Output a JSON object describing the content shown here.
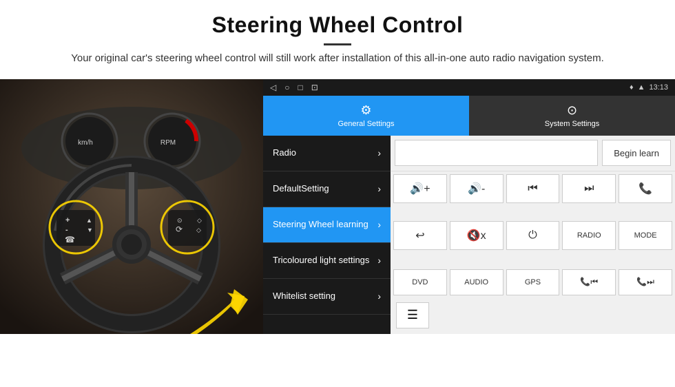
{
  "header": {
    "title": "Steering Wheel Control",
    "subtitle": "Your original car's steering wheel control will still work after installation of this all-in-one auto radio navigation system."
  },
  "statusBar": {
    "time": "13:13",
    "icons": [
      "◁",
      "○",
      "□",
      "⊡"
    ]
  },
  "navTabs": [
    {
      "id": "general",
      "label": "General Settings",
      "icon": "⚙",
      "active": true
    },
    {
      "id": "system",
      "label": "System Settings",
      "icon": "⊙",
      "active": false
    }
  ],
  "menuItems": [
    {
      "id": "radio",
      "label": "Radio",
      "active": false
    },
    {
      "id": "default",
      "label": "DefaultSetting",
      "active": false
    },
    {
      "id": "steering",
      "label": "Steering Wheel learning",
      "active": true
    },
    {
      "id": "tricoloured",
      "label": "Tricoloured light settings",
      "active": false
    },
    {
      "id": "whitelist",
      "label": "Whitelist setting",
      "active": false
    }
  ],
  "beginLearnBtn": "Begin learn",
  "controlButtons": {
    "row1": [
      {
        "label": "🔊+",
        "type": "icon"
      },
      {
        "label": "🔊-",
        "type": "icon"
      },
      {
        "label": "⏮",
        "type": "icon"
      },
      {
        "label": "⏭",
        "type": "icon"
      },
      {
        "label": "📞",
        "type": "icon"
      }
    ],
    "row2": [
      {
        "label": "↩",
        "type": "icon"
      },
      {
        "label": "🔇",
        "type": "icon"
      },
      {
        "label": "⏻",
        "type": "icon"
      },
      {
        "label": "RADIO",
        "type": "text"
      },
      {
        "label": "MODE",
        "type": "text"
      }
    ],
    "row3": [
      {
        "label": "DVD",
        "type": "text"
      },
      {
        "label": "AUDIO",
        "type": "text"
      },
      {
        "label": "GPS",
        "type": "text"
      },
      {
        "label": "📞⏮",
        "type": "icon"
      },
      {
        "label": "📞⏭",
        "type": "icon"
      }
    ]
  }
}
